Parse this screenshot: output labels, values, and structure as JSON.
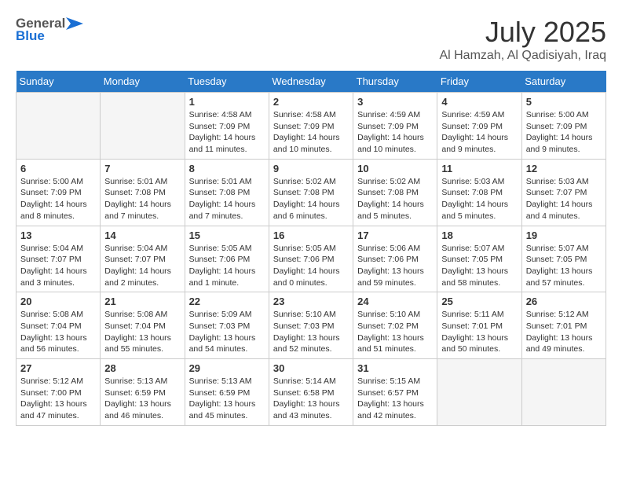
{
  "header": {
    "logo_general": "General",
    "logo_blue": "Blue",
    "month": "July 2025",
    "location": "Al Hamzah, Al Qadisiyah, Iraq"
  },
  "weekdays": [
    "Sunday",
    "Monday",
    "Tuesday",
    "Wednesday",
    "Thursday",
    "Friday",
    "Saturday"
  ],
  "weeks": [
    [
      {
        "day": "",
        "info": ""
      },
      {
        "day": "",
        "info": ""
      },
      {
        "day": "1",
        "info": "Sunrise: 4:58 AM\nSunset: 7:09 PM\nDaylight: 14 hours and 11 minutes."
      },
      {
        "day": "2",
        "info": "Sunrise: 4:58 AM\nSunset: 7:09 PM\nDaylight: 14 hours and 10 minutes."
      },
      {
        "day": "3",
        "info": "Sunrise: 4:59 AM\nSunset: 7:09 PM\nDaylight: 14 hours and 10 minutes."
      },
      {
        "day": "4",
        "info": "Sunrise: 4:59 AM\nSunset: 7:09 PM\nDaylight: 14 hours and 9 minutes."
      },
      {
        "day": "5",
        "info": "Sunrise: 5:00 AM\nSunset: 7:09 PM\nDaylight: 14 hours and 9 minutes."
      }
    ],
    [
      {
        "day": "6",
        "info": "Sunrise: 5:00 AM\nSunset: 7:09 PM\nDaylight: 14 hours and 8 minutes."
      },
      {
        "day": "7",
        "info": "Sunrise: 5:01 AM\nSunset: 7:08 PM\nDaylight: 14 hours and 7 minutes."
      },
      {
        "day": "8",
        "info": "Sunrise: 5:01 AM\nSunset: 7:08 PM\nDaylight: 14 hours and 7 minutes."
      },
      {
        "day": "9",
        "info": "Sunrise: 5:02 AM\nSunset: 7:08 PM\nDaylight: 14 hours and 6 minutes."
      },
      {
        "day": "10",
        "info": "Sunrise: 5:02 AM\nSunset: 7:08 PM\nDaylight: 14 hours and 5 minutes."
      },
      {
        "day": "11",
        "info": "Sunrise: 5:03 AM\nSunset: 7:08 PM\nDaylight: 14 hours and 5 minutes."
      },
      {
        "day": "12",
        "info": "Sunrise: 5:03 AM\nSunset: 7:07 PM\nDaylight: 14 hours and 4 minutes."
      }
    ],
    [
      {
        "day": "13",
        "info": "Sunrise: 5:04 AM\nSunset: 7:07 PM\nDaylight: 14 hours and 3 minutes."
      },
      {
        "day": "14",
        "info": "Sunrise: 5:04 AM\nSunset: 7:07 PM\nDaylight: 14 hours and 2 minutes."
      },
      {
        "day": "15",
        "info": "Sunrise: 5:05 AM\nSunset: 7:06 PM\nDaylight: 14 hours and 1 minute."
      },
      {
        "day": "16",
        "info": "Sunrise: 5:05 AM\nSunset: 7:06 PM\nDaylight: 14 hours and 0 minutes."
      },
      {
        "day": "17",
        "info": "Sunrise: 5:06 AM\nSunset: 7:06 PM\nDaylight: 13 hours and 59 minutes."
      },
      {
        "day": "18",
        "info": "Sunrise: 5:07 AM\nSunset: 7:05 PM\nDaylight: 13 hours and 58 minutes."
      },
      {
        "day": "19",
        "info": "Sunrise: 5:07 AM\nSunset: 7:05 PM\nDaylight: 13 hours and 57 minutes."
      }
    ],
    [
      {
        "day": "20",
        "info": "Sunrise: 5:08 AM\nSunset: 7:04 PM\nDaylight: 13 hours and 56 minutes."
      },
      {
        "day": "21",
        "info": "Sunrise: 5:08 AM\nSunset: 7:04 PM\nDaylight: 13 hours and 55 minutes."
      },
      {
        "day": "22",
        "info": "Sunrise: 5:09 AM\nSunset: 7:03 PM\nDaylight: 13 hours and 54 minutes."
      },
      {
        "day": "23",
        "info": "Sunrise: 5:10 AM\nSunset: 7:03 PM\nDaylight: 13 hours and 52 minutes."
      },
      {
        "day": "24",
        "info": "Sunrise: 5:10 AM\nSunset: 7:02 PM\nDaylight: 13 hours and 51 minutes."
      },
      {
        "day": "25",
        "info": "Sunrise: 5:11 AM\nSunset: 7:01 PM\nDaylight: 13 hours and 50 minutes."
      },
      {
        "day": "26",
        "info": "Sunrise: 5:12 AM\nSunset: 7:01 PM\nDaylight: 13 hours and 49 minutes."
      }
    ],
    [
      {
        "day": "27",
        "info": "Sunrise: 5:12 AM\nSunset: 7:00 PM\nDaylight: 13 hours and 47 minutes."
      },
      {
        "day": "28",
        "info": "Sunrise: 5:13 AM\nSunset: 6:59 PM\nDaylight: 13 hours and 46 minutes."
      },
      {
        "day": "29",
        "info": "Sunrise: 5:13 AM\nSunset: 6:59 PM\nDaylight: 13 hours and 45 minutes."
      },
      {
        "day": "30",
        "info": "Sunrise: 5:14 AM\nSunset: 6:58 PM\nDaylight: 13 hours and 43 minutes."
      },
      {
        "day": "31",
        "info": "Sunrise: 5:15 AM\nSunset: 6:57 PM\nDaylight: 13 hours and 42 minutes."
      },
      {
        "day": "",
        "info": ""
      },
      {
        "day": "",
        "info": ""
      }
    ]
  ]
}
